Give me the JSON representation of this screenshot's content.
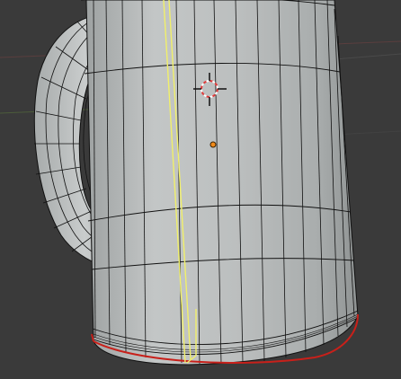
{
  "viewport": {
    "background": "#3a3a3a",
    "mesh_fill": "#b9bcbc",
    "wire_color": "#111111",
    "selected_edge_color": "#f1f06a",
    "selected_loop_color": "#c8201a",
    "grid_line_red": "#8a4a4a",
    "grid_line_green": "#5c7a3a",
    "origin_color": "#f08a1a",
    "cursor_color_1": "#e03a3a",
    "cursor_color_2": "#ffffff"
  },
  "objects": {
    "mug": {
      "icon": "mug-mesh",
      "edit_mode": true
    },
    "cursor_3d": {
      "icon": "3d-cursor-icon"
    },
    "object_origin": {
      "icon": "origin-dot"
    }
  }
}
